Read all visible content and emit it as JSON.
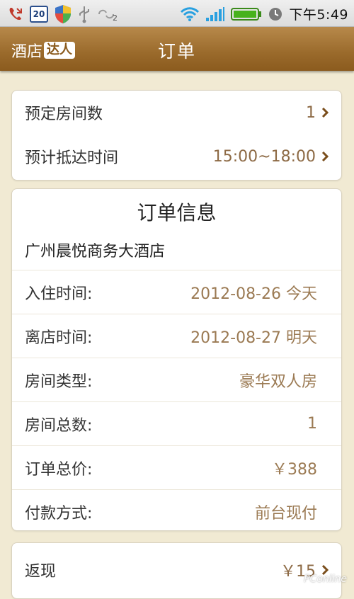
{
  "statusbar": {
    "calendar_day": "20",
    "notification_count": "2",
    "time": "下午5:49",
    "icons": [
      "phone-icon",
      "calendar-icon",
      "shield-icon",
      "usb-icon",
      "sync-icon",
      "wifi-icon",
      "signal-icon",
      "battery-icon",
      "clock-icon"
    ]
  },
  "header": {
    "brand_text": "酒店",
    "brand_badge": "达人",
    "title": "订单"
  },
  "booking": {
    "rooms_label": "预定房间数",
    "rooms_value": "1",
    "arrival_label": "预计抵达时间",
    "arrival_value": "15:00~18:00"
  },
  "order": {
    "title": "订单信息",
    "hotel_name": "广州晨悦商务大酒店",
    "rows": [
      {
        "label": "入住时间:",
        "value": "2012-08-26 今天"
      },
      {
        "label": "离店时间:",
        "value": "2012-08-27 明天"
      },
      {
        "label": "房间类型:",
        "value": "豪华双人房"
      },
      {
        "label": "房间总数:",
        "value": "1"
      },
      {
        "label": "订单总价:",
        "value": "￥388"
      },
      {
        "label": "付款方式:",
        "value": "前台现付"
      }
    ]
  },
  "cashback": {
    "label": "返现",
    "value": "￥15"
  },
  "watermark": "PConline"
}
